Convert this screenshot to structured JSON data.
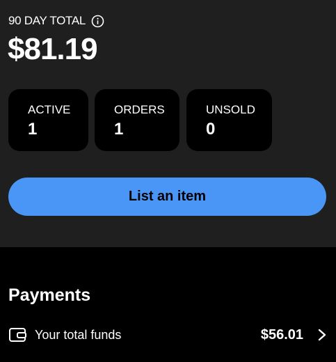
{
  "summary": {
    "total_label": "90 DAY TOTAL",
    "total_value": "$81.19",
    "info_icon": "info-icon"
  },
  "stats": [
    {
      "label": "ACTIVE",
      "value": "1"
    },
    {
      "label": "ORDERS",
      "value": "1"
    },
    {
      "label": "UNSOLD",
      "value": "0"
    }
  ],
  "actions": {
    "list_button_label": "List an item"
  },
  "payments": {
    "title": "Payments",
    "funds_label": "Your total funds",
    "funds_value": "$56.01",
    "wallet_icon": "wallet-icon",
    "chevron_icon": "chevron-right-icon"
  },
  "colors": {
    "panel_background": "#1f1f1f",
    "page_background": "#000000",
    "accent": "#4a96f7"
  }
}
